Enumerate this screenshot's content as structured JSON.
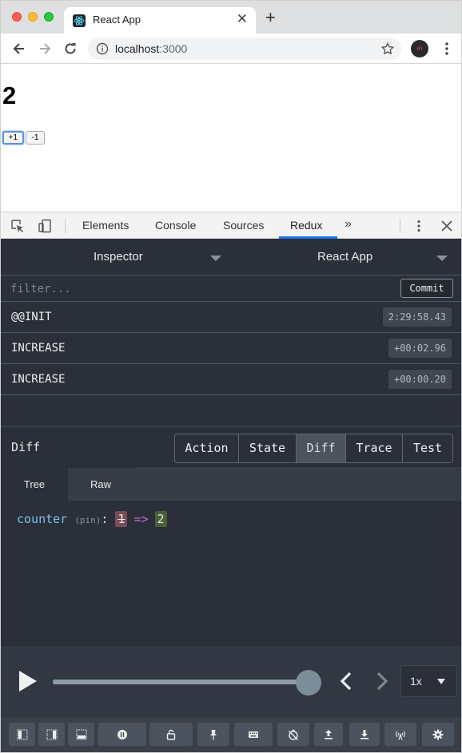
{
  "browser": {
    "tab_title": "React App",
    "url_host": "localhost",
    "url_port": ":3000"
  },
  "app": {
    "counter_value": "2",
    "increment_label": "+1",
    "decrement_label": "-1"
  },
  "devtools": {
    "tabs": [
      "Elements",
      "Console",
      "Sources",
      "Redux"
    ],
    "active_tab": "Redux"
  },
  "redux": {
    "monitor_select": "Inspector",
    "instance_select": "React App",
    "filter_placeholder": "filter...",
    "commit_label": "Commit",
    "actions": [
      {
        "name": "@@INIT",
        "time": "2:29:58.43"
      },
      {
        "name": "INCREASE",
        "time": "+00:02.96"
      },
      {
        "name": "INCREASE",
        "time": "+00:00.20"
      }
    ],
    "diff_title": "Diff",
    "segments": [
      "Action",
      "State",
      "Diff",
      "Trace",
      "Test"
    ],
    "active_segment": "Diff",
    "subtabs": [
      "Tree",
      "Raw"
    ],
    "active_subtab": "Tree",
    "diff": {
      "key": "counter",
      "pin": "(pin)",
      "colon": ":",
      "old": "1",
      "arrow": "=>",
      "new": "2"
    },
    "player": {
      "speed": "1x",
      "position": 1.0
    },
    "bottom_icons": [
      "dock-left-icon",
      "dock-right-icon",
      "dock-bottom-icon",
      "pause-icon",
      "lock-icon",
      "pin-icon",
      "keyboard-icon",
      "timer-off-icon",
      "upload-icon",
      "download-icon",
      "remote-icon",
      "settings-icon"
    ]
  },
  "colors": {
    "accent": "#1a73e8",
    "panel_bg": "#2a2f3a",
    "diff_key": "#7cc0e6",
    "diff_old_bg": "#7a4c59",
    "diff_new_bg": "#4a5e38",
    "diff_arrow": "#d166d1"
  }
}
